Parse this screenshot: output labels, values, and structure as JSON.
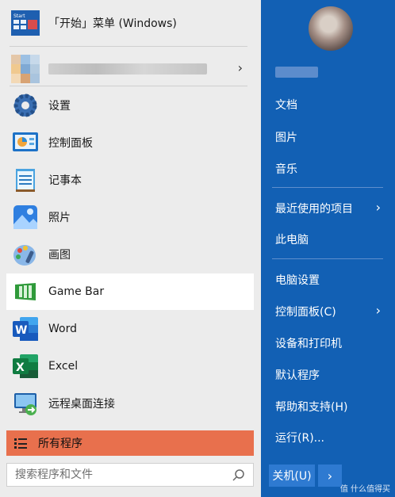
{
  "left": {
    "pinned": {
      "label": "「开始」菜单 (Windows)",
      "icon": "start-tile-icon"
    },
    "recent": {
      "icon": "blurred-app-icon"
    },
    "apps": [
      {
        "label": "设置",
        "icon": "gear-icon"
      },
      {
        "label": "控制面板",
        "icon": "control-panel-icon"
      },
      {
        "label": "记事本",
        "icon": "notepad-icon"
      },
      {
        "label": "照片",
        "icon": "photos-icon"
      },
      {
        "label": "画图",
        "icon": "paint-icon"
      },
      {
        "label": "Game Bar",
        "icon": "game-bar-icon"
      },
      {
        "label": "Word",
        "icon": "word-icon"
      },
      {
        "label": "Excel",
        "icon": "excel-icon"
      },
      {
        "label": "远程桌面连接",
        "icon": "remote-desktop-icon"
      }
    ],
    "all_programs": "所有程序",
    "search_placeholder": "搜索程序和文件"
  },
  "right": {
    "items": [
      {
        "label": "文档"
      },
      {
        "label": "图片"
      },
      {
        "label": "音乐"
      },
      {
        "label": "最近使用的项目"
      },
      {
        "label": "此电脑"
      },
      {
        "label": "电脑设置"
      },
      {
        "label": "控制面板(C)"
      },
      {
        "label": "设备和打印机"
      },
      {
        "label": "默认程序"
      },
      {
        "label": "帮助和支持(H)"
      },
      {
        "label": "运行(R)..."
      }
    ],
    "power_label": "关机(U)",
    "watermark": "值 什么值得买"
  },
  "colors": {
    "accent_blue": "#1260b4",
    "all_programs_orange": "#e8704d",
    "left_bg": "#ececec"
  }
}
